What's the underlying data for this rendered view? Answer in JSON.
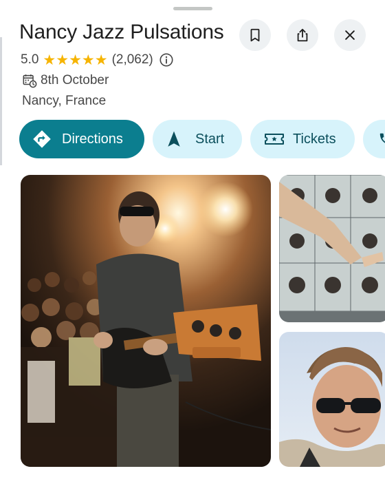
{
  "place": {
    "title": "Nancy Jazz Pulsations",
    "rating": "5.0",
    "review_count": "(2,062)",
    "date": "8th October",
    "location": "Nancy, France"
  },
  "header_icons": [
    "bookmark-icon",
    "share-icon",
    "close-icon"
  ],
  "actions": [
    {
      "label": "Directions",
      "icon": "directions-icon"
    },
    {
      "label": "Start",
      "icon": "navigation-arrow-icon"
    },
    {
      "label": "Tickets",
      "icon": "ticket-icon"
    },
    {
      "label": "",
      "icon": "phone-icon"
    }
  ],
  "colors": {
    "primary_chip": "#0b7e8f",
    "tonal_chip": "#d7f3fb",
    "star": "#f6b400",
    "text": "#1f1f1f",
    "secondary_text": "#474747"
  },
  "photos": [
    {
      "description_icon": "concert-photo"
    },
    {
      "description_icon": "posters-photo"
    },
    {
      "description_icon": "portrait-photo"
    }
  ]
}
